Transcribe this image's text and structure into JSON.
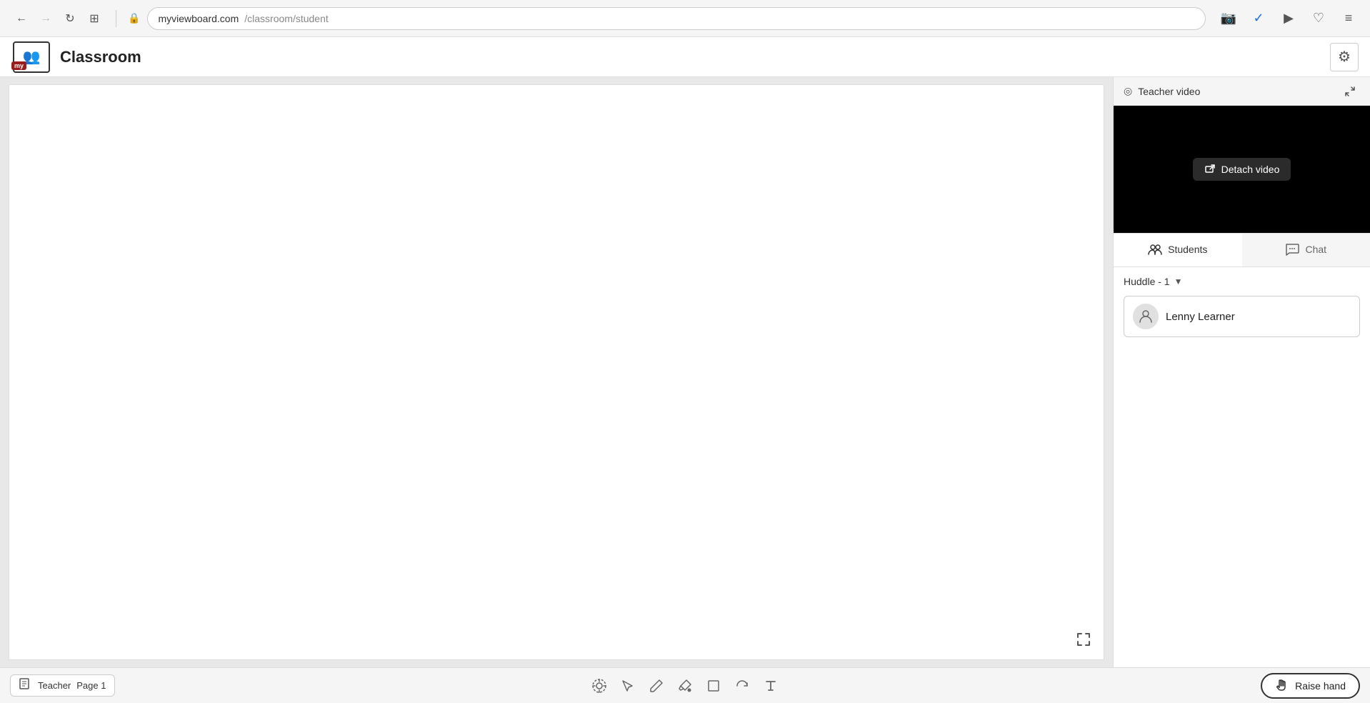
{
  "browser": {
    "url_base": "myviewboard.com",
    "url_path": "/classroom/student",
    "back_disabled": false,
    "forward_disabled": true
  },
  "app": {
    "title": "Classroom",
    "logo_badge": "my"
  },
  "teacher_video": {
    "label": "Teacher video",
    "detach_button": "Detach video"
  },
  "tabs": {
    "students_label": "Students",
    "chat_label": "Chat"
  },
  "huddle": {
    "label": "Huddle - 1"
  },
  "students": [
    {
      "name": "Lenny Learner"
    }
  ],
  "bottom": {
    "teacher_label": "Teacher",
    "page_label": "Page 1",
    "raise_hand_label": "Raise hand"
  },
  "tools": {
    "move": "⊕",
    "select": "◻",
    "pen": "✏",
    "eraser": "◆",
    "shape": "□",
    "transform": "↺",
    "text": "T"
  }
}
